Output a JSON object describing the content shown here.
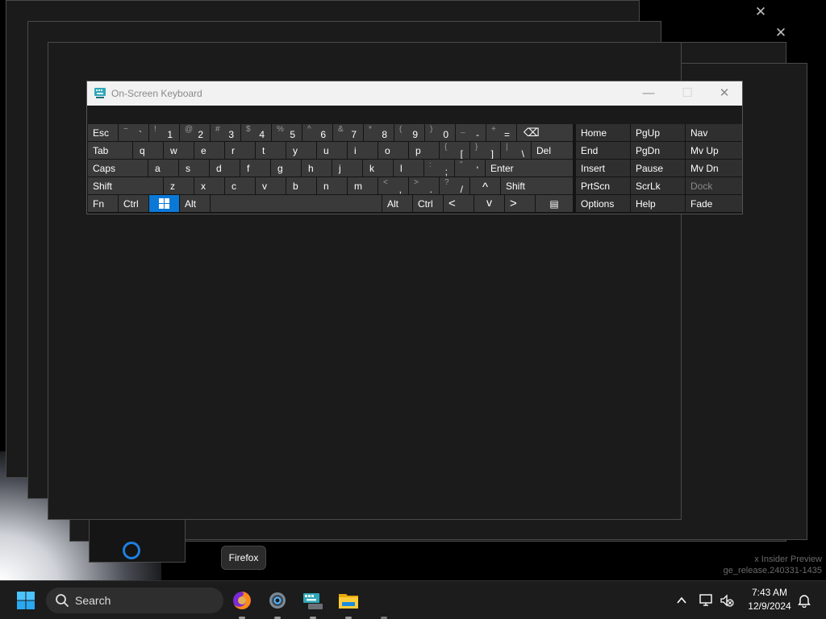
{
  "background": {
    "watermark_lines": [
      "x Insider Preview",
      "ge_release.240331-1435"
    ]
  },
  "window": {
    "title": "On-Screen Keyboard",
    "minimize": "—",
    "maximize": "☐",
    "close": "✕",
    "background_close_glyph": "✕"
  },
  "keyboard": {
    "row1": [
      {
        "label": "Esc"
      },
      {
        "shift": "~",
        "primary": "`"
      },
      {
        "shift": "!",
        "primary": "1"
      },
      {
        "shift": "@",
        "primary": "2"
      },
      {
        "shift": "#",
        "primary": "3"
      },
      {
        "shift": "$",
        "primary": "4"
      },
      {
        "shift": "%",
        "primary": "5"
      },
      {
        "shift": "^",
        "primary": "6"
      },
      {
        "shift": "&",
        "primary": "7"
      },
      {
        "shift": "*",
        "primary": "8"
      },
      {
        "shift": "(",
        "primary": "9"
      },
      {
        "shift": ")",
        "primary": "0"
      },
      {
        "shift": "_",
        "primary": "-"
      },
      {
        "shift": "+",
        "primary": "="
      },
      {
        "label": "⌫"
      }
    ],
    "row2": [
      {
        "label": "Tab"
      },
      {
        "label": "q"
      },
      {
        "label": "w"
      },
      {
        "label": "e"
      },
      {
        "label": "r"
      },
      {
        "label": "t"
      },
      {
        "label": "y"
      },
      {
        "label": "u"
      },
      {
        "label": "i"
      },
      {
        "label": "o"
      },
      {
        "label": "p"
      },
      {
        "shift": "{",
        "primary": "["
      },
      {
        "shift": "}",
        "primary": "]"
      },
      {
        "shift": "|",
        "primary": "\\"
      },
      {
        "label": "Del"
      }
    ],
    "row3": [
      {
        "label": "Caps"
      },
      {
        "label": "a"
      },
      {
        "label": "s"
      },
      {
        "label": "d"
      },
      {
        "label": "f"
      },
      {
        "label": "g"
      },
      {
        "label": "h"
      },
      {
        "label": "j"
      },
      {
        "label": "k"
      },
      {
        "label": "l"
      },
      {
        "shift": ":",
        "primary": ";"
      },
      {
        "shift": "\"",
        "primary": "'"
      },
      {
        "label": "Enter"
      }
    ],
    "row4": [
      {
        "label": "Shift"
      },
      {
        "label": "z"
      },
      {
        "label": "x"
      },
      {
        "label": "c"
      },
      {
        "label": "v"
      },
      {
        "label": "b"
      },
      {
        "label": "n"
      },
      {
        "label": "m"
      },
      {
        "shift": "<",
        "primary": ","
      },
      {
        "shift": ">",
        "primary": "."
      },
      {
        "shift": "?",
        "primary": "/"
      },
      {
        "label": "^"
      },
      {
        "label": "Shift"
      }
    ],
    "row5": [
      {
        "label": "Fn"
      },
      {
        "label": "Ctrl"
      },
      {
        "label": "⊞"
      },
      {
        "label": "Alt"
      },
      {
        "label": ""
      },
      {
        "label": "Alt"
      },
      {
        "label": "Ctrl"
      },
      {
        "label": "<"
      },
      {
        "label": "v"
      },
      {
        "label": ">"
      },
      {
        "label": "▤"
      }
    ],
    "nav": {
      "row1": [
        "Home",
        "PgUp",
        "Nav"
      ],
      "row2": [
        "End",
        "PgDn",
        "Mv Up"
      ],
      "row3": [
        "Insert",
        "Pause",
        "Mv Dn"
      ],
      "row4": [
        "PrtScn",
        "ScrLk",
        "Dock"
      ],
      "row5": [
        "Options",
        "Help",
        "Fade"
      ]
    }
  },
  "tooltip": {
    "text": "Firefox"
  },
  "taskbar": {
    "search_label": "Search",
    "apps": [
      "start-icon",
      "firefox-icon",
      "settings-icon",
      "on-screen-keyboard-icon",
      "file-explorer-icon"
    ],
    "time": "7:43 AM",
    "date": "12/9/2024",
    "accent": "#0a78d7"
  }
}
